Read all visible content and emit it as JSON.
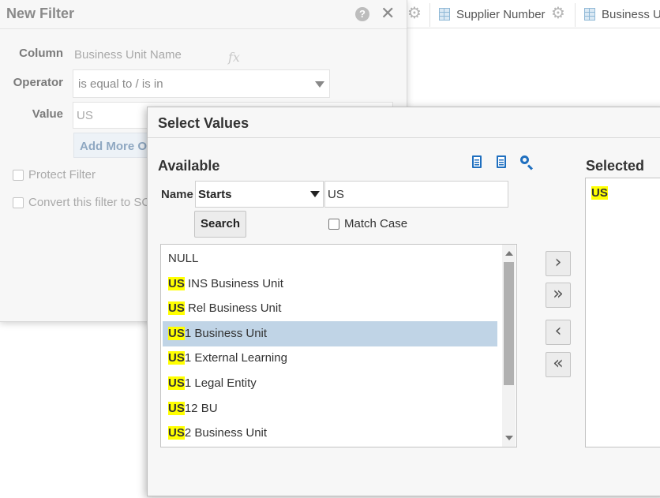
{
  "background": {
    "columns": [
      {
        "label": "Supplier Number"
      },
      {
        "label": "Business U"
      }
    ]
  },
  "new_filter": {
    "title": "New Filter",
    "help": "?",
    "close": "✕",
    "column_label": "Column",
    "column_value": "Business Unit Name",
    "fx": "fx",
    "operator_label": "Operator",
    "operator_value": "is equal to / is in",
    "value_label": "Value",
    "value_value": "US",
    "add_more": "Add More O",
    "protect_filter": "Protect Filter",
    "convert_filter": "Convert this filter to SC"
  },
  "select_values": {
    "title": "Select Values",
    "available_label": "Available",
    "selected_label": "Selected",
    "name_label": "Name",
    "match_operator": "Starts",
    "search_text": "US",
    "search_button": "Search",
    "match_case": "Match Case",
    "available_items": [
      {
        "prefix": "",
        "rest": "NULL"
      },
      {
        "prefix": "US",
        "rest": " INS Business Unit"
      },
      {
        "prefix": "US",
        "rest": " Rel Business Unit"
      },
      {
        "prefix": "US",
        "rest": "1 Business Unit"
      },
      {
        "prefix": "US",
        "rest": "1 External Learning"
      },
      {
        "prefix": "US",
        "rest": "1 Legal Entity"
      },
      {
        "prefix": "US",
        "rest": "12 BU"
      },
      {
        "prefix": "US",
        "rest": "2 Business Unit"
      }
    ],
    "selected_row_index": 3,
    "move_buttons": [
      "›",
      "»",
      "‹",
      "«"
    ],
    "selected_items": [
      "US"
    ]
  }
}
